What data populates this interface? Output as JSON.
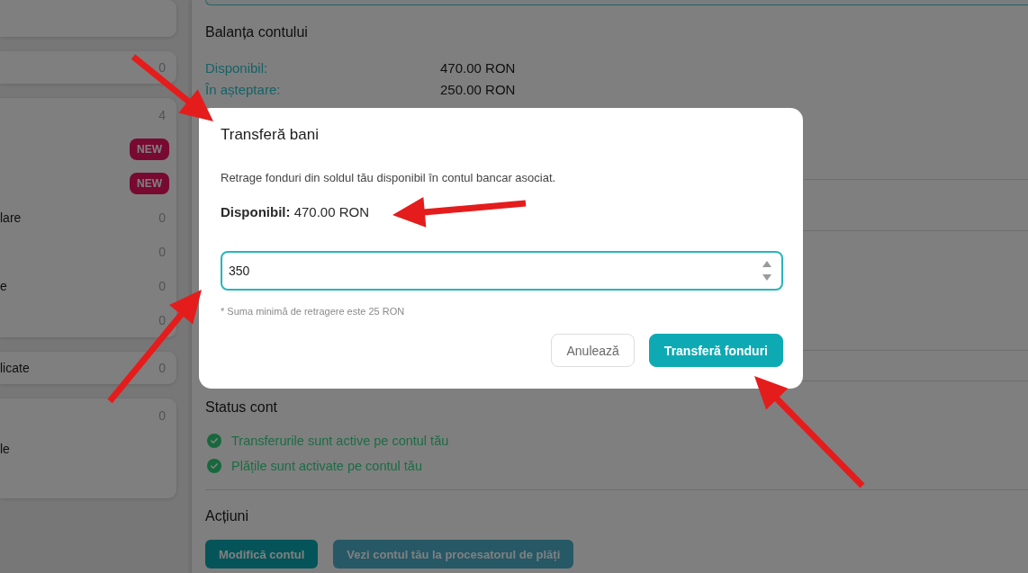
{
  "sidebar": {
    "cards": [
      {
        "rows": [
          {
            "kind": "count",
            "count": "0"
          }
        ]
      },
      {
        "rows": [
          {
            "kind": "count",
            "count": "4"
          },
          {
            "kind": "badge",
            "badge": "NEW"
          },
          {
            "kind": "badge",
            "badge": "NEW"
          },
          {
            "kind": "count",
            "label": "lare",
            "count": "0"
          },
          {
            "kind": "count",
            "count": "0"
          },
          {
            "kind": "count",
            "label": "e",
            "count": "0"
          },
          {
            "kind": "count",
            "count": "0"
          }
        ]
      },
      {
        "rows": [
          {
            "kind": "count",
            "label": "licate",
            "count": "0"
          }
        ]
      },
      {
        "rows": [
          {
            "kind": "count",
            "count": "0"
          },
          {
            "kind": "label",
            "label": "le"
          }
        ]
      }
    ]
  },
  "balance": {
    "title": "Balanța contului",
    "rows": [
      {
        "label": "Disponibil:",
        "value": "470.00 RON"
      },
      {
        "label": "În așteptare:",
        "value": "250.00 RON"
      }
    ]
  },
  "status": {
    "title": "Status cont",
    "items": [
      "Transferurile sunt active pe contul tău",
      "Plățile sunt activate pe contul tău"
    ]
  },
  "actions": {
    "title": "Acțiuni",
    "buttons": [
      {
        "label": "Modifică contul",
        "kind": "primary"
      },
      {
        "label": "Vezi contul tău la procesatorul de plăți",
        "kind": "secondary"
      }
    ]
  },
  "dialog": {
    "title": "Transferă bani",
    "description": "Retrage fonduri din soldul tău disponibil în contul bancar asociat.",
    "available": "**Disponibil:** 470.00 RON",
    "amount_field": {
      "value": "350"
    },
    "hint": "* Suma minimă de retragere este 25 RON",
    "buttons": [
      {
        "label": "Anulează",
        "kind": "secondary"
      },
      {
        "label": "Transferă fonduri",
        "kind": "primary"
      }
    ]
  },
  "annotations": [
    {
      "kind": "arrow"
    },
    {
      "kind": "arrow"
    },
    {
      "kind": "arrow"
    },
    {
      "kind": "arrow"
    }
  ]
}
